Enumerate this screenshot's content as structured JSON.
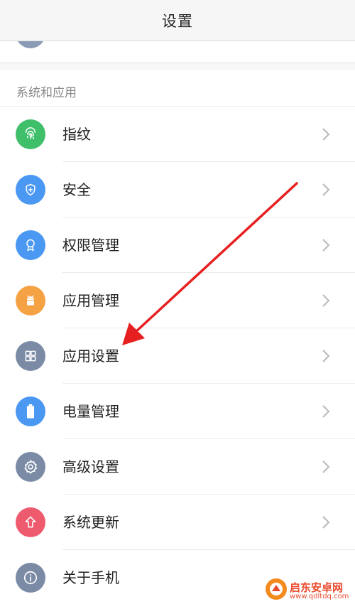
{
  "header": {
    "title": "设置"
  },
  "section": {
    "title": "系统和应用",
    "items": [
      {
        "label": "指纹",
        "icon": "fingerprint-icon",
        "color": "#3fbf6a"
      },
      {
        "label": "安全",
        "icon": "shield-icon",
        "color": "#4a98f2"
      },
      {
        "label": "权限管理",
        "icon": "badge-icon",
        "color": "#4a98f2"
      },
      {
        "label": "应用管理",
        "icon": "android-icon",
        "color": "#f5a245"
      },
      {
        "label": "应用设置",
        "icon": "grid-icon",
        "color": "#7b8ba6"
      },
      {
        "label": "电量管理",
        "icon": "battery-icon",
        "color": "#4a98f2"
      },
      {
        "label": "高级设置",
        "icon": "gear-icon",
        "color": "#7b8ba6"
      },
      {
        "label": "系统更新",
        "icon": "upload-arrow-icon",
        "color": "#ee5a6e"
      },
      {
        "label": "关于手机",
        "icon": "info-icon",
        "color": "#7b8ba6"
      }
    ]
  },
  "watermark": {
    "brand": "启东安卓网",
    "url": "www.qdltdq.com"
  },
  "colors": {
    "chevron": "#b9b9b9",
    "arrow": "#e62020"
  }
}
